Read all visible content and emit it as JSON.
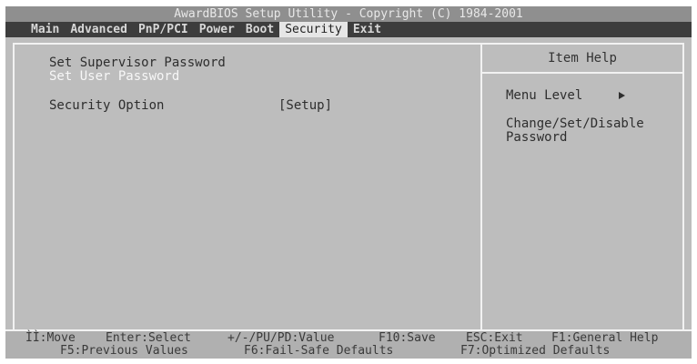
{
  "title": "AwardBIOS Setup Utility - Copyright (C) 1984-2001",
  "menu": [
    {
      "label": "Main"
    },
    {
      "label": "Advanced"
    },
    {
      "label": "PnP/PCI"
    },
    {
      "label": "Power"
    },
    {
      "label": "Boot"
    },
    {
      "label": "Security",
      "active": true
    },
    {
      "label": "Exit"
    }
  ],
  "items": [
    {
      "label": "Set Supervisor Password"
    },
    {
      "label": "Set User Password",
      "selected": true
    },
    {
      "label": "Security Option",
      "value": "[Setup]"
    }
  ],
  "help": {
    "header": "Item Help",
    "menu_level_label": "Menu Level",
    "arrow_icon": "right-triangle-icon",
    "text_line1": "Change/Set/Disable",
    "text_line2": "Password"
  },
  "footer": {
    "keys": [
      {
        "text": "ÌÌ:Move"
      },
      {
        "text": "Enter:Select"
      },
      {
        "text": "+/-/PU/PD:Value"
      },
      {
        "text": "F10:Save"
      },
      {
        "text": "ESC:Exit"
      },
      {
        "text": "F1:General Help"
      },
      {
        "text": "F5:Previous Values"
      },
      {
        "text": "F6:Fail-Safe Defaults"
      },
      {
        "text": "F7:Optimized Defaults"
      }
    ]
  }
}
